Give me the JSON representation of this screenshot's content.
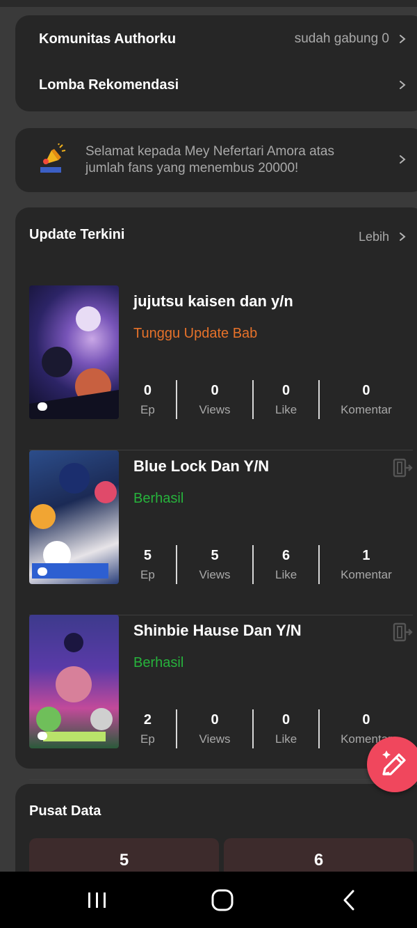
{
  "community": {
    "row1_title": "Komunitas Authorku",
    "row1_meta": "sudah gabung 0",
    "row2_title": "Lomba Rekomendasi"
  },
  "announcement": {
    "icon": "megaphone-icon",
    "text": "Selamat kepada Mey Nefertari Amora atas jumlah fans yang menembus 20000!"
  },
  "updates": {
    "title": "Update Terkini",
    "more_label": "Lebih",
    "stat_labels": [
      "Ep",
      "Views",
      "Like",
      "Komentar"
    ],
    "stories": [
      {
        "title": "jujutsu kaisen dan y/n",
        "status": "Tunggu Update Bab",
        "ep": "0",
        "views": "0",
        "like": "0",
        "comments": "0"
      },
      {
        "title": "Blue Lock Dan Y/N",
        "status": "Berhasil",
        "ep": "5",
        "views": "5",
        "like": "6",
        "comments": "1"
      },
      {
        "title": "Shinbie Hause Dan Y/N",
        "status": "Berhasil",
        "ep": "2",
        "views": "0",
        "like": "0",
        "comments": "0"
      }
    ]
  },
  "data_center": {
    "title": "Pusat Data",
    "values": [
      "5",
      "6"
    ]
  },
  "colors": {
    "pending": "#e7722a",
    "success": "#27b33c",
    "fab": "#f0475d"
  },
  "icons": {
    "fab": "pencil-sparkle-icon",
    "exit": "exit-icon",
    "nav": [
      "recents-icon",
      "home-icon",
      "back-icon"
    ]
  }
}
